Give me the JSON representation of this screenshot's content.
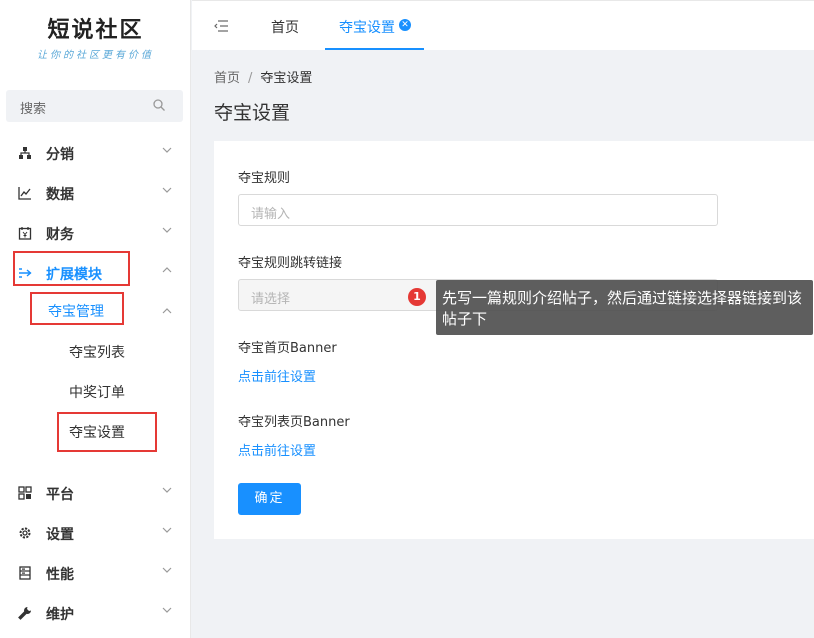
{
  "logo": {
    "main": "短说社区",
    "sub": "让你的社区更有价值"
  },
  "sidebar": {
    "search_label": "搜索",
    "items": [
      {
        "label": "分销"
      },
      {
        "label": "数据"
      },
      {
        "label": "财务"
      },
      {
        "label": "扩展模块"
      },
      {
        "label": "平台"
      },
      {
        "label": "设置"
      },
      {
        "label": "性能"
      },
      {
        "label": "维护"
      }
    ],
    "submenu": {
      "label": "夺宝管理"
    },
    "subitems": [
      {
        "label": "夺宝列表"
      },
      {
        "label": "中奖订单"
      },
      {
        "label": "夺宝设置"
      }
    ]
  },
  "tabs": [
    {
      "label": "首页"
    },
    {
      "label": "夺宝设置"
    }
  ],
  "breadcrumb": {
    "home": "首页",
    "sep": "/",
    "current": "夺宝设置"
  },
  "page_title": "夺宝设置",
  "form": {
    "rule_label": "夺宝规则",
    "rule_placeholder": "请输入",
    "link_label": "夺宝规则跳转链接",
    "link_placeholder": "请选择",
    "home_banner_label": "夺宝首页Banner",
    "home_banner_link": "点击前往设置",
    "list_banner_label": "夺宝列表页Banner",
    "list_banner_link": "点击前往设置",
    "submit": "确定"
  },
  "annotation": {
    "step": "1",
    "text": "先写一篇规则介绍帖子，然后通过链接选择器链接到该帖子下"
  },
  "colors": {
    "accent": "#1890ff",
    "highlight": "#e53935"
  }
}
